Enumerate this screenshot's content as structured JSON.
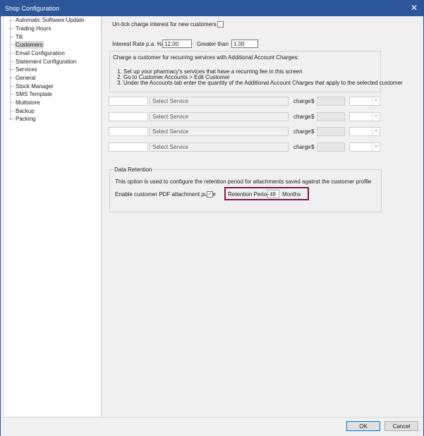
{
  "window": {
    "title": "Shop Configuration",
    "close_glyph": "✕"
  },
  "tree": {
    "items": [
      {
        "label": "Automatic Software Update"
      },
      {
        "label": "Trading Hours"
      },
      {
        "label": "Till"
      },
      {
        "label": "Customers",
        "selected": true
      },
      {
        "label": "Email Configuration"
      },
      {
        "label": "Statement Configuration"
      },
      {
        "label": "Services"
      },
      {
        "label": "General"
      },
      {
        "label": "Stock Manager"
      },
      {
        "label": "SMS Template"
      },
      {
        "label": "Multistore"
      },
      {
        "label": "Backup"
      },
      {
        "label": "Packing"
      }
    ]
  },
  "customers": {
    "untick_interest_label": "Un-tick charge interest for new customers",
    "untick_interest_checked": false,
    "interest_rate_label": "Interest Rate p.a. %",
    "interest_rate_value": "12.00",
    "greater_than_label": "Greater than",
    "greater_than_value": "1.00",
    "additional_charges": {
      "heading": "Charge a customer for recurring services with Additional Account Charges:",
      "steps": [
        "1. Set up your pharmacy's services that have a recurring fee in this screen",
        "2. Go to Customer Accounts > Edit Customer",
        "3. Under the Accounts tab enter the quantity of the Additional Account Charges that apply to the selected customer"
      ]
    },
    "service_rows": [
      {
        "select_label": "Select Service",
        "charge_label": "charge",
        "currency": "$"
      },
      {
        "select_label": "Select Service",
        "charge_label": "charge",
        "currency": "$"
      },
      {
        "select_label": "Select Service",
        "charge_label": "charge",
        "currency": "$"
      },
      {
        "select_label": "Select Service",
        "charge_label": "charge",
        "currency": "$"
      }
    ],
    "data_retention": {
      "title": "Data Retention",
      "description": "This option is used to configure the retention period for attachments saved against the customer profile",
      "pdf_purge_label": "Enable customer PDF attachment purge",
      "pdf_purge_checked": true,
      "retention_period_label": "Retention Period",
      "retention_period_value": "48",
      "retention_unit": "Months",
      "highlight_color": "#7b1a4a"
    }
  },
  "footer": {
    "ok_label": "OK",
    "cancel_label": "Cancel"
  },
  "icons": {
    "close": "close-icon",
    "checkbox_check": "✓",
    "dropdown": "chevron-down-icon"
  }
}
